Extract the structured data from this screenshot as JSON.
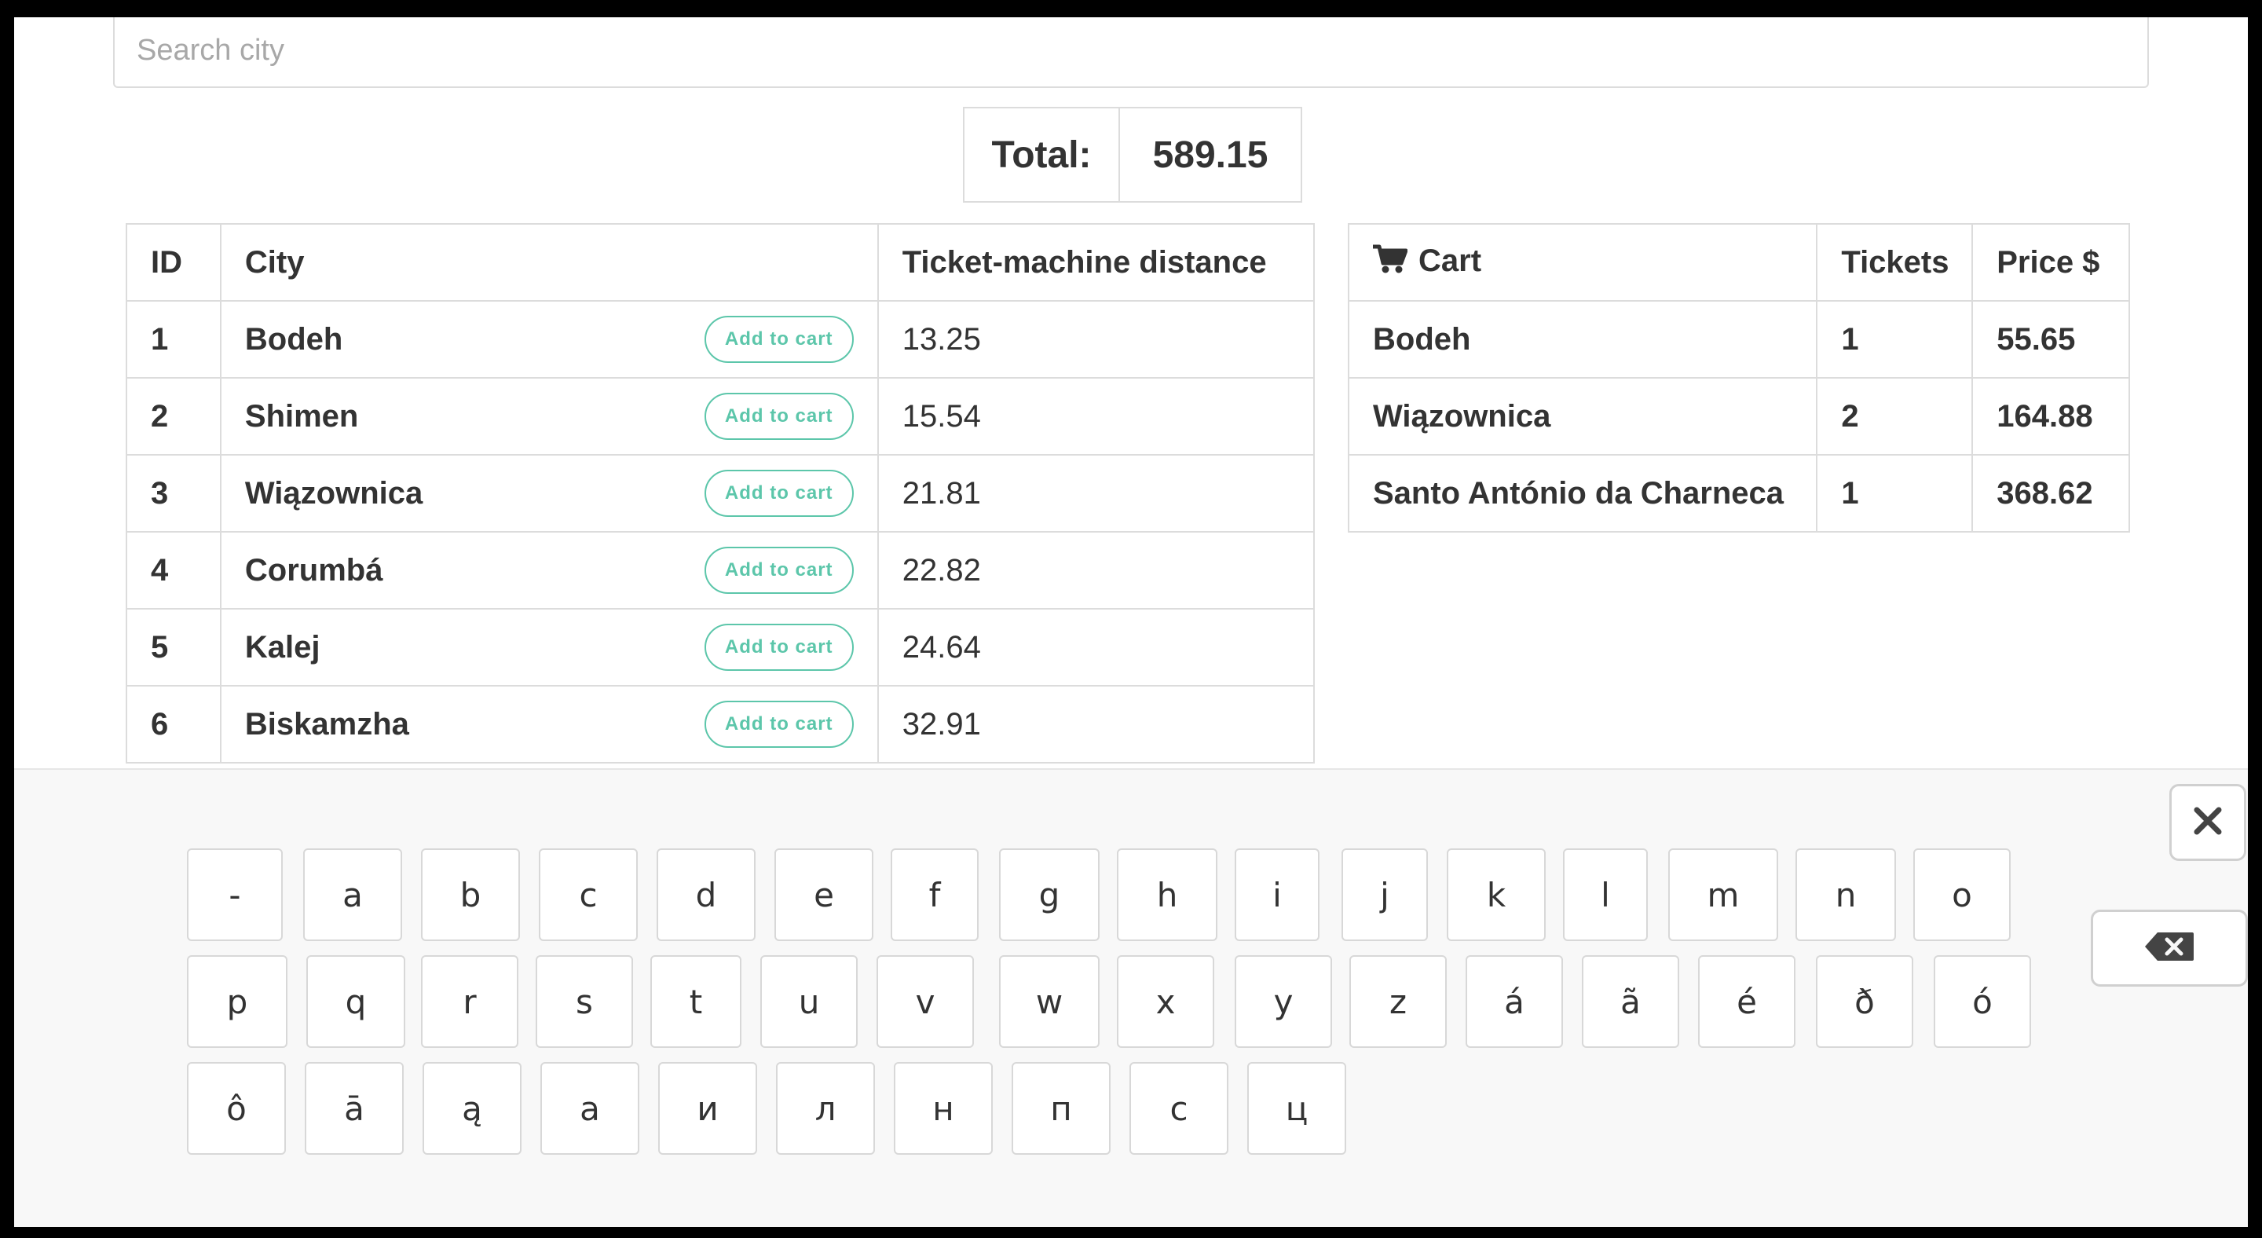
{
  "search": {
    "placeholder": "Search city",
    "value": ""
  },
  "total": {
    "label": "Total:",
    "value": "589.15"
  },
  "cities_table": {
    "headers": {
      "id": "ID",
      "city": "City",
      "distance": "Ticket-machine distance"
    },
    "add_label": "Add to cart",
    "rows": [
      {
        "id": "1",
        "city": "Bodeh",
        "distance": "13.25"
      },
      {
        "id": "2",
        "city": "Shimen",
        "distance": "15.54"
      },
      {
        "id": "3",
        "city": "Wiązownica",
        "distance": "21.81"
      },
      {
        "id": "4",
        "city": "Corumbá",
        "distance": "22.82"
      },
      {
        "id": "5",
        "city": "Kalej",
        "distance": "24.64"
      },
      {
        "id": "6",
        "city": "Biskamzha",
        "distance": "32.91"
      }
    ]
  },
  "cart_table": {
    "headers": {
      "cart": "Cart",
      "tickets": "Tickets",
      "price": "Price $"
    },
    "cart_icon": "shopping-cart-icon",
    "rows": [
      {
        "city": "Bodeh",
        "tickets": "1",
        "price": "55.65"
      },
      {
        "city": "Wiązownica",
        "tickets": "2",
        "price": "164.88"
      },
      {
        "city": "Santo António da Charneca",
        "tickets": "1",
        "price": "368.62"
      }
    ]
  },
  "keyboard": {
    "rows": [
      [
        "-",
        "a",
        "b",
        "c",
        "d",
        "e",
        "f",
        "g",
        "h",
        "i",
        "j",
        "k",
        "l",
        "m",
        "n",
        "o"
      ],
      [
        "p",
        "q",
        "r",
        "s",
        "t",
        "u",
        "v",
        "w",
        "x",
        "y",
        "z",
        "á",
        "ã",
        "é",
        "ð",
        "ó"
      ],
      [
        "ô",
        "ā",
        "ą",
        "а",
        "и",
        "л",
        "н",
        "п",
        "с",
        "ц"
      ]
    ],
    "close_icon": "close-icon",
    "backspace_icon": "backspace-icon"
  }
}
